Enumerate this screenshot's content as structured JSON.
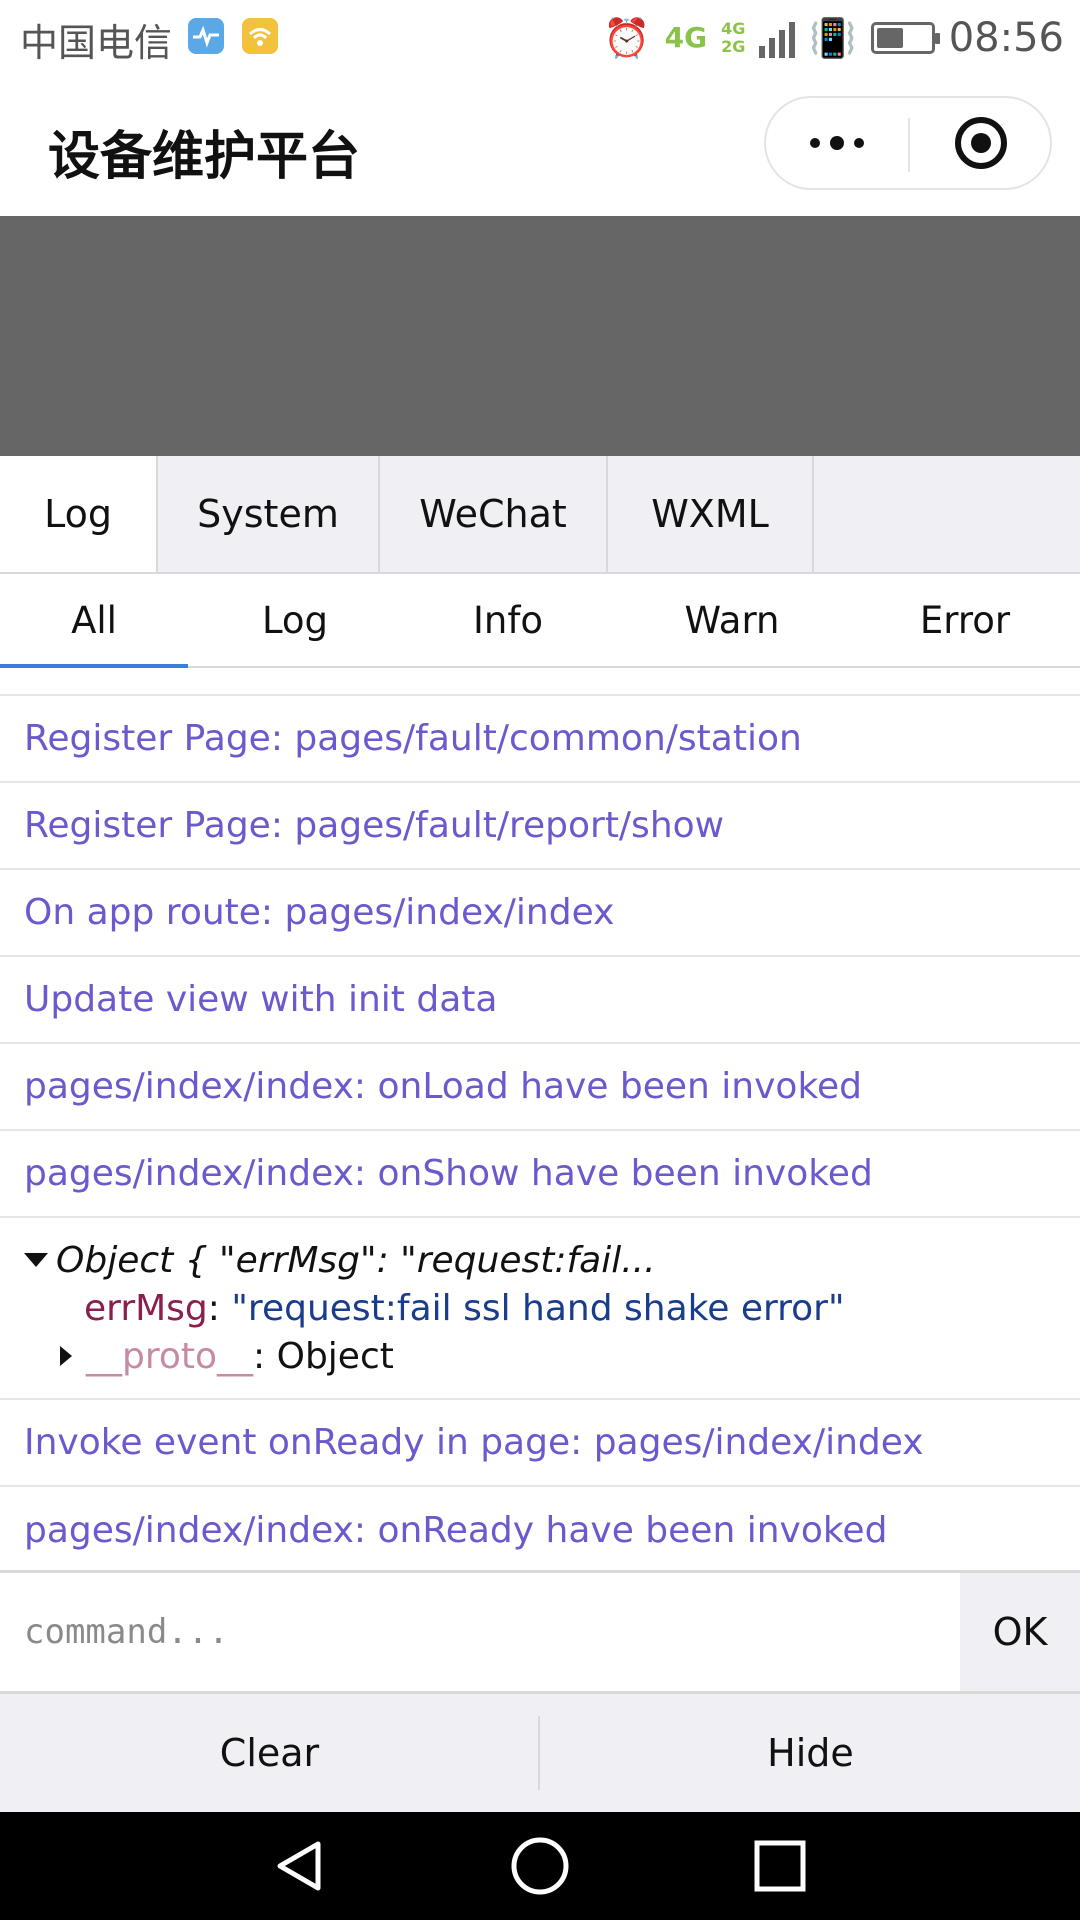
{
  "status_bar": {
    "carrier": "中国电信",
    "network_primary": "4G",
    "network_secondary_top": "4G",
    "network_secondary_bottom": "2G",
    "time": "08:56",
    "battery_level": 0.5
  },
  "title_bar": {
    "title": "设备维护平台"
  },
  "main_tabs": [
    {
      "label": "Log",
      "active": true
    },
    {
      "label": "System",
      "active": false
    },
    {
      "label": "WeChat",
      "active": false
    },
    {
      "label": "WXML",
      "active": false
    }
  ],
  "sub_tabs": [
    {
      "label": "All",
      "active": true
    },
    {
      "label": "Log",
      "active": false
    },
    {
      "label": "Info",
      "active": false
    },
    {
      "label": "Warn",
      "active": false
    },
    {
      "label": "Error",
      "active": false
    }
  ],
  "logs": {
    "before_object": [
      "Register Page: pages/fault/common/station",
      "Register Page: pages/fault/report/show",
      "On app route: pages/index/index",
      "Update view with init data",
      "pages/index/index: onLoad have been invoked",
      "pages/index/index: onShow have been invoked"
    ],
    "object_entry": {
      "summary": "Object { \"errMsg\": \"request:fail...",
      "key": "errMsg",
      "value": "\"request:fail ssl hand shake error\"",
      "proto_key": "__proto__",
      "proto_value": "Object"
    },
    "after_object": [
      "Invoke event onReady in page: pages/index/index",
      "pages/index/index: onReady have been invoked"
    ]
  },
  "command": {
    "placeholder": "command...",
    "ok_label": "OK"
  },
  "bottom_buttons": {
    "clear_label": "Clear",
    "hide_label": "Hide"
  },
  "colors": {
    "log_text": "#6a5acd",
    "active_underline": "#3c7cdc",
    "gray_band": "#666666",
    "network_green": "#8bc34a"
  }
}
